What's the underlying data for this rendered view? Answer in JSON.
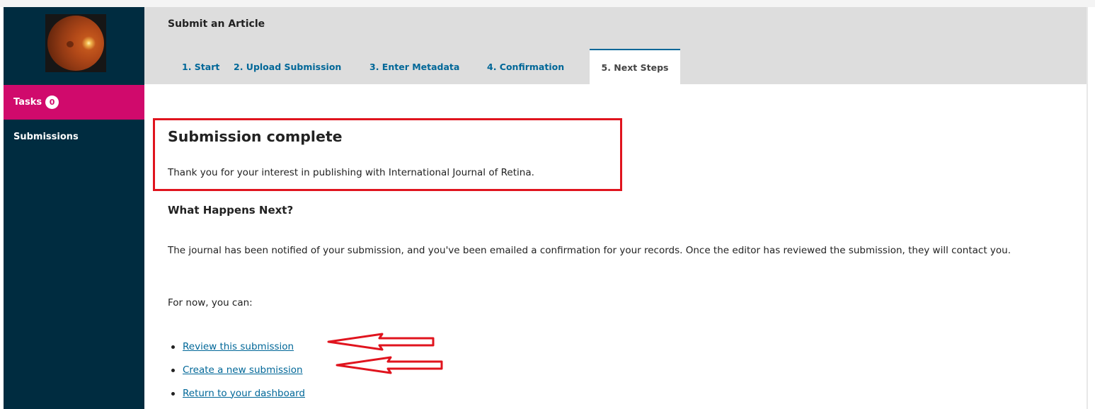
{
  "sidebar": {
    "logo_alt": "Journal logo (retina fundus)",
    "items": [
      {
        "label": "Tasks",
        "badge": "0"
      },
      {
        "label": "Submissions"
      }
    ]
  },
  "header": {
    "title": "Submit an Article",
    "tabs": [
      {
        "label": "1. Start"
      },
      {
        "label": "2. Upload Submission"
      },
      {
        "label": "3. Enter Metadata"
      },
      {
        "label": "4. Confirmation"
      },
      {
        "label": "5. Next Steps",
        "active": true
      }
    ]
  },
  "main": {
    "heading": "Submission complete",
    "thanks": "Thank you for your interest in publishing with International Journal of Retina.",
    "next_heading": "What Happens Next?",
    "paragraph": "The journal has been notified of your submission, and you've been emailed a confirmation for your records. Once the editor has reviewed the submission, they will contact you.",
    "for_now": "For now, you can:",
    "links": [
      {
        "label": "Review this submission"
      },
      {
        "label": "Create a new submission"
      },
      {
        "label": "Return to your dashboard"
      }
    ]
  },
  "colors": {
    "sidebar_bg": "#002c40",
    "accent_pink": "#d00a6c",
    "link_blue": "#006798",
    "annotation_red": "#e0141e"
  }
}
